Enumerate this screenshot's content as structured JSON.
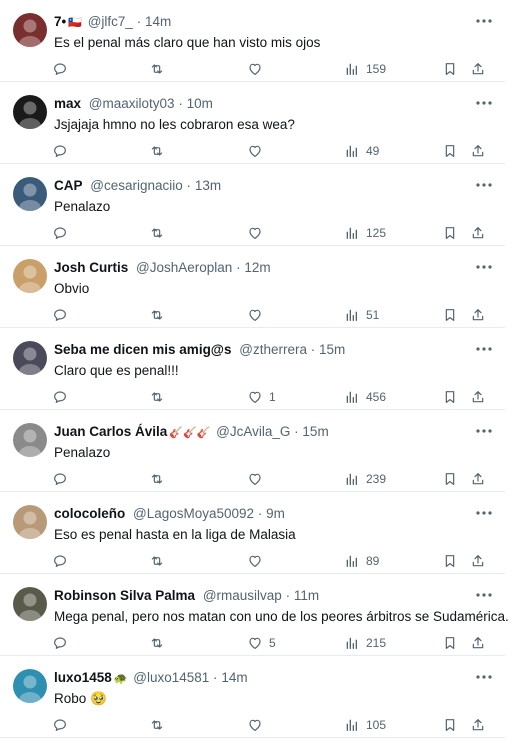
{
  "colors": {
    "text": "#0f1419",
    "muted": "#536471",
    "divider": "#e6ecf0"
  },
  "icons": {
    "reply": "reply-icon",
    "retweet": "retweet-icon",
    "like": "heart-icon",
    "views": "bar-chart-icon",
    "bookmark": "bookmark-icon",
    "share": "share-icon",
    "more": "more-icon"
  },
  "replies": [
    {
      "name": "7•",
      "name_emoji": "🇨🇱",
      "handle": "@jlfc7_",
      "time": "14m",
      "text": "Es el penal más claro que han visto mis ojos",
      "likes": "",
      "views": "159",
      "avatar_color": "#7a2f2f"
    },
    {
      "name": "max",
      "name_emoji": "",
      "handle": "@maaxiloty03",
      "time": "10m",
      "text": "Jsjajaja hmno no les cobraron esa wea?",
      "likes": "",
      "views": "49",
      "avatar_color": "#1a1a1a"
    },
    {
      "name": "CAP",
      "name_emoji": "",
      "handle": "@cesarignaciio",
      "time": "13m",
      "text": "Penalazo",
      "likes": "",
      "views": "125",
      "avatar_color": "#3b5b7a"
    },
    {
      "name": "Josh Curtis",
      "name_emoji": "",
      "handle": "@JoshAeroplan",
      "time": "12m",
      "text": "Obvio",
      "likes": "",
      "views": "51",
      "avatar_color": "#c9a06a"
    },
    {
      "name": "Seba me dicen mis amig@s",
      "name_emoji": "",
      "handle": "@ztherrera",
      "time": "15m",
      "text": "Claro que es penal!!!",
      "likes": "1",
      "views": "456",
      "avatar_color": "#4a4a5a"
    },
    {
      "name": "Juan Carlos Ávila",
      "name_emoji": "🎸🎸🎸",
      "handle": "@JcAvila_G",
      "time": "15m",
      "text": "Penalazo",
      "likes": "",
      "views": "239",
      "avatar_color": "#8a8a8a"
    },
    {
      "name": "colocoleño",
      "name_emoji": "",
      "handle": "@LagosMoya50092",
      "time": "9m",
      "text": "Eso es penal hasta en la liga de Malasia",
      "likes": "",
      "views": "89",
      "avatar_color": "#b89a78"
    },
    {
      "name": "Robinson Silva Palma",
      "name_emoji": "",
      "handle": "@rmausilvap",
      "time": "11m",
      "text": "Mega penal, pero nos matan con uno de los peores árbitros se Sudamérica.",
      "likes": "5",
      "views": "215",
      "avatar_color": "#5a5a4a"
    },
    {
      "name": "luxo1458",
      "name_emoji": "🐢",
      "handle": "@luxo14581",
      "time": "14m",
      "text": "Robo 🥹",
      "likes": "",
      "views": "105",
      "avatar_color": "#2f8fb0"
    }
  ]
}
